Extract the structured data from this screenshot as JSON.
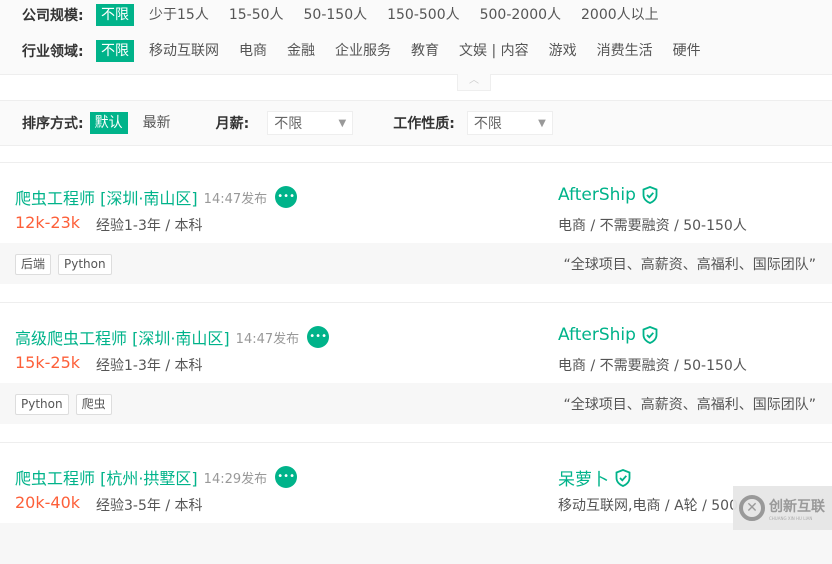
{
  "filters": {
    "size": {
      "label": "公司规模:",
      "options": [
        "不限",
        "少于15人",
        "15-50人",
        "50-150人",
        "150-500人",
        "500-2000人",
        "2000人以上"
      ]
    },
    "industry": {
      "label": "行业领域:",
      "options": [
        "不限",
        "移动互联网",
        "电商",
        "金融",
        "企业服务",
        "教育",
        "文娱 | 内容",
        "游戏",
        "消费生活",
        "硬件"
      ]
    },
    "collapse_icon": "chevron-up-icon"
  },
  "sort": {
    "label": "排序方式:",
    "options": [
      "默认",
      "最新"
    ],
    "salary_label": "月薪:",
    "salary_value": "不限",
    "type_label": "工作性质:",
    "type_value": "不限"
  },
  "jobs": [
    {
      "title": "爬虫工程师 [深圳·南山区]",
      "time": "14:47发布",
      "salary": "12k-23k",
      "req": "经验1-3年 / 本科",
      "company": "AfterShip",
      "info": "电商 / 不需要融资 / 50-150人",
      "tags": [
        "后端",
        "Python"
      ],
      "slogan": "“全球项目、高薪资、高福利、国际团队”"
    },
    {
      "title": "高级爬虫工程师 [深圳·南山区]",
      "time": "14:47发布",
      "salary": "15k-25k",
      "req": "经验1-3年 / 本科",
      "company": "AfterShip",
      "info": "电商 / 不需要融资 / 50-150人",
      "tags": [
        "Python",
        "爬虫"
      ],
      "slogan": "“全球项目、高薪资、高福利、国际团队”"
    },
    {
      "title": "爬虫工程师 [杭州·拱墅区]",
      "time": "14:29发布",
      "salary": "20k-40k",
      "req": "经验3-5年 / 本科",
      "company": "呆萝卜",
      "info": "移动互联网,电商 / A轮 / 500",
      "tags": [],
      "slogan": ""
    }
  ],
  "watermark": {
    "text": "创新互联",
    "sub": "CHUANG XIN HU LIAN"
  },
  "colors": {
    "accent": "#00b38a",
    "salary": "#fd5f39"
  }
}
